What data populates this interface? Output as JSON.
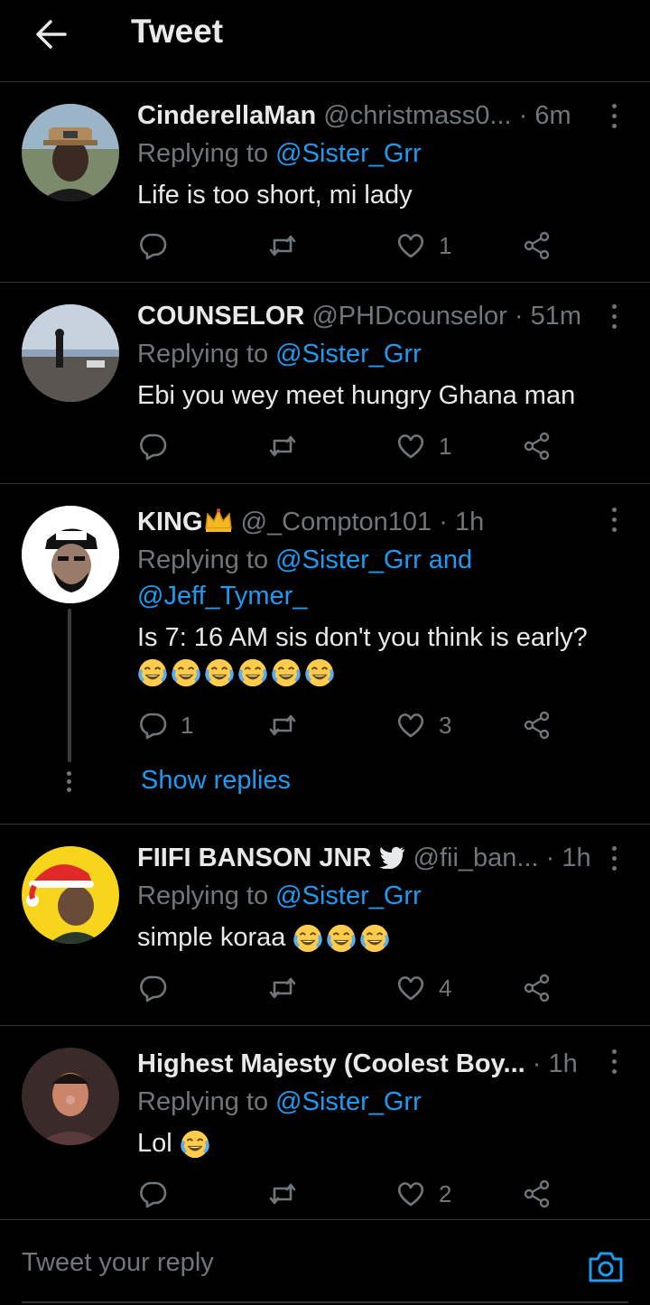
{
  "header": {
    "title": "Tweet",
    "back_icon": "arrow-left-icon"
  },
  "colors": {
    "background": "#000000",
    "accent": "#1d9bf0",
    "muted": "#71767b",
    "text": "#e7e9ea"
  },
  "tweets": [
    {
      "name": "CinderellaMan",
      "handle": "@christmass0...",
      "separator": "·",
      "time": "6m",
      "reply_prefix": "Replying to ",
      "reply_to": "@Sister_Grr",
      "text": "Life is too short, mi lady",
      "emoji_count": 0,
      "reply_count": "",
      "retweet_count": "",
      "like_count": "1"
    },
    {
      "name": "COUNSELOR",
      "handle": "@PHDcounselor",
      "separator": "·",
      "time": "51m",
      "reply_prefix": "Replying to ",
      "reply_to": "@Sister_Grr",
      "text": "Ebi you wey meet hungry Ghana man",
      "emoji_count": 0,
      "reply_count": "",
      "retweet_count": "",
      "like_count": "1"
    },
    {
      "name": "KING",
      "name_badge": "crown-emoji",
      "handle": "@_Compton101",
      "separator": "·",
      "time": "1h",
      "reply_prefix": "Replying to ",
      "reply_to": "@Sister_Grr",
      "reply_and": " and",
      "reply_to_2": "@Jeff_Tymer_",
      "text": "Is 7: 16 AM sis don't you think is early?",
      "emoji_count": 6,
      "reply_count": "1",
      "retweet_count": "",
      "like_count": "3",
      "show_replies": "Show replies"
    },
    {
      "name": "FIIFI BANSON JNR",
      "name_badge": "twitter-bird-icon",
      "handle": "@fii_ban...",
      "separator": "·",
      "time": "1h",
      "reply_prefix": "Replying to ",
      "reply_to": "@Sister_Grr",
      "text": "simple koraa",
      "emoji_count": 3,
      "reply_count": "",
      "retweet_count": "",
      "like_count": "4"
    },
    {
      "name": "Highest Majesty (Coolest Boy...",
      "handle": "",
      "separator": "·",
      "time": "1h",
      "reply_prefix": "Replying to ",
      "reply_to": "@Sister_Grr",
      "text": "Lol",
      "emoji_count": 1,
      "reply_count": "",
      "retweet_count": "",
      "like_count": "2"
    }
  ],
  "compose": {
    "placeholder": "Tweet your reply",
    "camera_icon": "camera-icon"
  }
}
